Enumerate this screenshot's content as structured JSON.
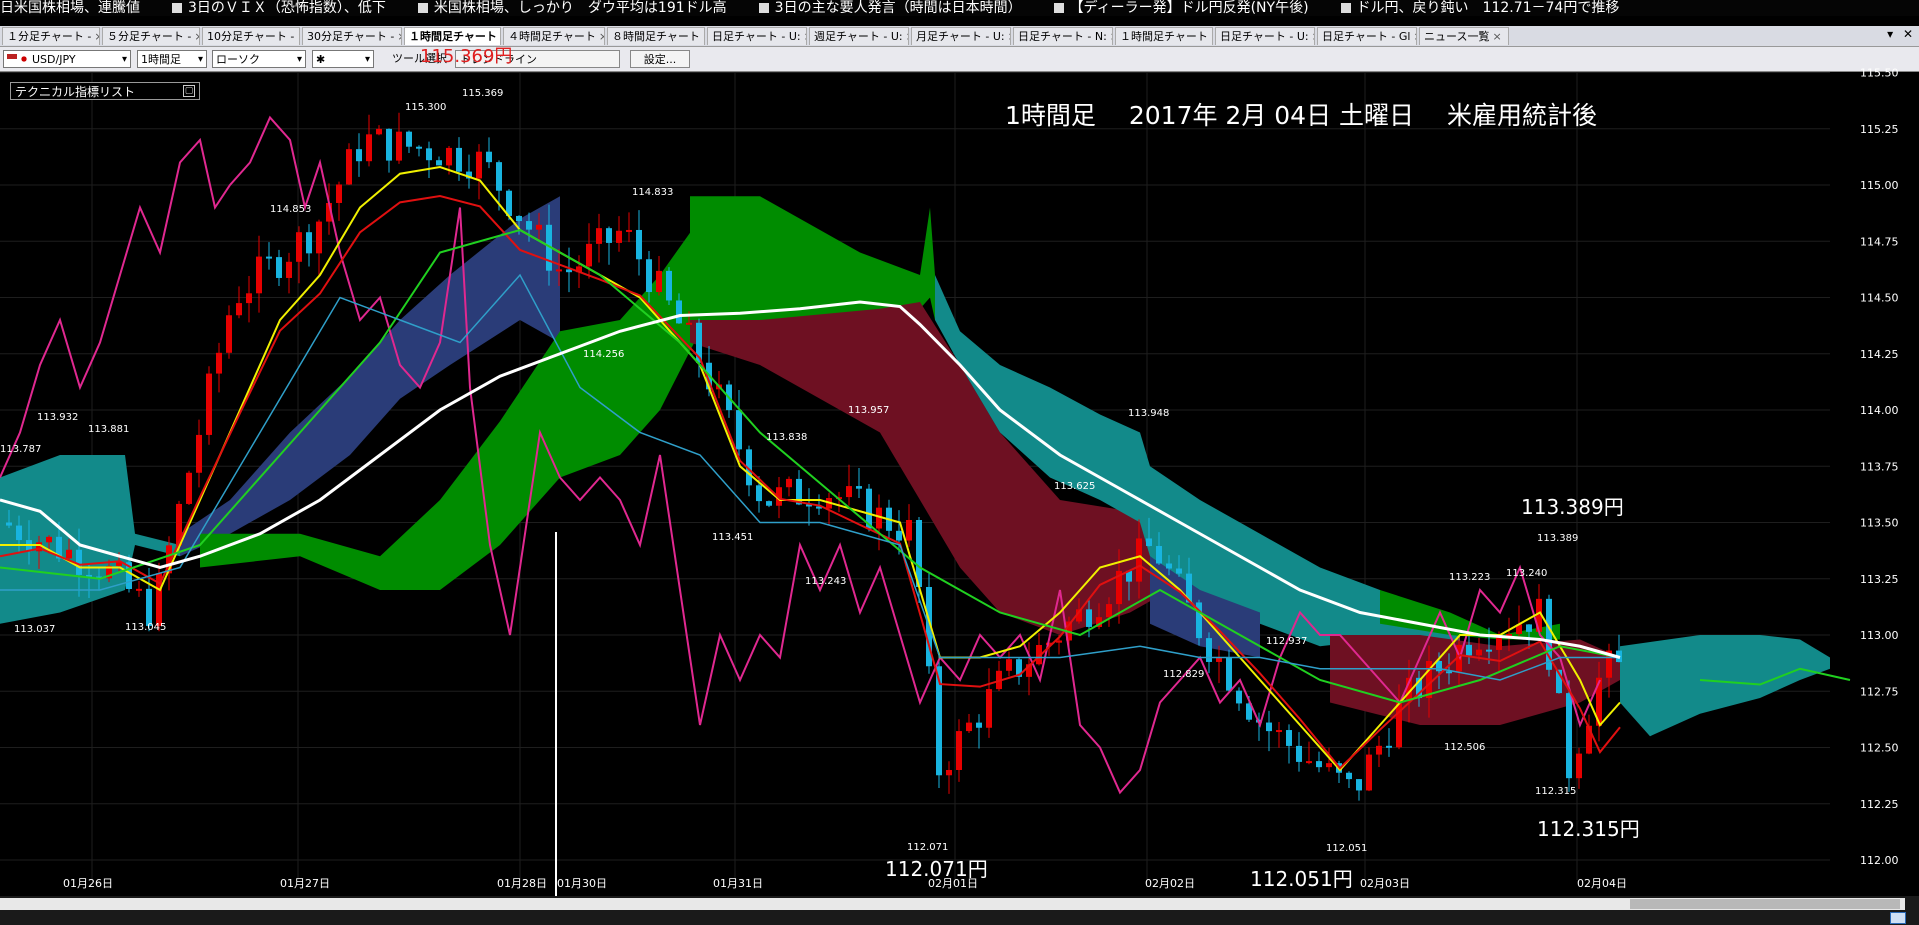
{
  "ticker": [
    "日米国株相場、連騰値",
    "3日のＶＩＸ（恐怖指数）、低下",
    "米国株相場、しっかり　ダウ平均は191ドル高",
    "3日の主な要人発言（時間は日本時間）",
    "【ディーラー発】ドル円反発(NY午後)",
    "ドル円、戻り鈍い　112.71－74円で推移"
  ],
  "tabs": [
    {
      "label": "１分足チャート -"
    },
    {
      "label": "５分足チャート -"
    },
    {
      "label": "10分足チャート -"
    },
    {
      "label": "30分足チャート -"
    },
    {
      "label": "１時間足チャート",
      "active": true
    },
    {
      "label": "４時間足チャート"
    },
    {
      "label": "８時間足チャート"
    },
    {
      "label": "日足チャート - U:"
    },
    {
      "label": "週足チャート - U:"
    },
    {
      "label": "月足チャート - U:"
    },
    {
      "label": "日足チャート - N:"
    },
    {
      "label": "１時間足チャート"
    },
    {
      "label": "日足チャート - U:"
    },
    {
      "label": "日足チャート - Gl"
    },
    {
      "label": "ニュース一覧"
    }
  ],
  "tab_close": "×",
  "toolbar": {
    "symbol": "USD/JPY",
    "timeframe": "1時間足",
    "chart_type": "ローソク",
    "marker": "✱",
    "tool_select": "ツール選択",
    "trendline": "トレンドライン",
    "settings": "設定..."
  },
  "indicator_list": "テクニカル指標リスト",
  "chart": {
    "title": "1時間足　 2017年 2月 04日 土曜日　 米雇用統計後",
    "y_ticks": [
      "115.50",
      "115.25",
      "115.00",
      "114.75",
      "114.50",
      "114.25",
      "114.00",
      "113.75",
      "113.50",
      "113.25",
      "113.00",
      "112.75",
      "112.50",
      "112.25",
      "112.00"
    ],
    "x_ticks": [
      "01月26日",
      "01月27日",
      "01月28日",
      "01月30日",
      "01月31日",
      "02月01日",
      "02月02日",
      "02月03日",
      "02月04日"
    ],
    "price_labels": [
      "113.787",
      "113.932",
      "113.881",
      "113.037",
      "113.045",
      "114.853",
      "115.300",
      "115.369",
      "114.833",
      "114.256",
      "113.957",
      "113.838",
      "113.451",
      "113.243",
      "112.071",
      "113.625",
      "113.948",
      "112.829",
      "112.937",
      "112.051",
      "113.223",
      "113.240",
      "113.389",
      "112.506",
      "112.315"
    ],
    "big_labels": [
      "113.389円",
      "112.071円",
      "112.051円",
      "112.315円"
    ],
    "red_annotation": "115.369円"
  },
  "colors": {
    "cloud_bull": "#008c00",
    "cloud_bear": "#6e1022",
    "cloud_teal": "#128a8a",
    "cloud_navy": "#2a3c78",
    "candle_up": "#e60000",
    "candle_down": "#18b4e0",
    "ma_short": "#f0f000",
    "ma_mid": "#20d020",
    "tenkan": "#e01010",
    "rsi_line": "#e02890",
    "long_ma": "#ffffff"
  },
  "chart_data": {
    "type": "candlestick",
    "title": "1時間足　 2017年 2月 04日 土曜日　 米雇用統計後",
    "ylim": [
      112.0,
      115.5
    ],
    "x": [
      "01月26日",
      "01月27日",
      "01月28日",
      "01月30日",
      "01月31日",
      "02月01日",
      "02月02日",
      "02月03日",
      "02月04日"
    ],
    "series": [
      {
        "name": "",
        "values": [
          113.5,
          113.3,
          113.1,
          114.5,
          115.3,
          115.1,
          114.6,
          114.3,
          113.9,
          113.6,
          112.6,
          113.3,
          113.4,
          112.8,
          112.4,
          113.0,
          112.9
        ]
      }
    ],
    "annotations": [
      "113.389円",
      "112.071円",
      "112.051円",
      "112.315円",
      "115.369円"
    ],
    "grid": true
  }
}
